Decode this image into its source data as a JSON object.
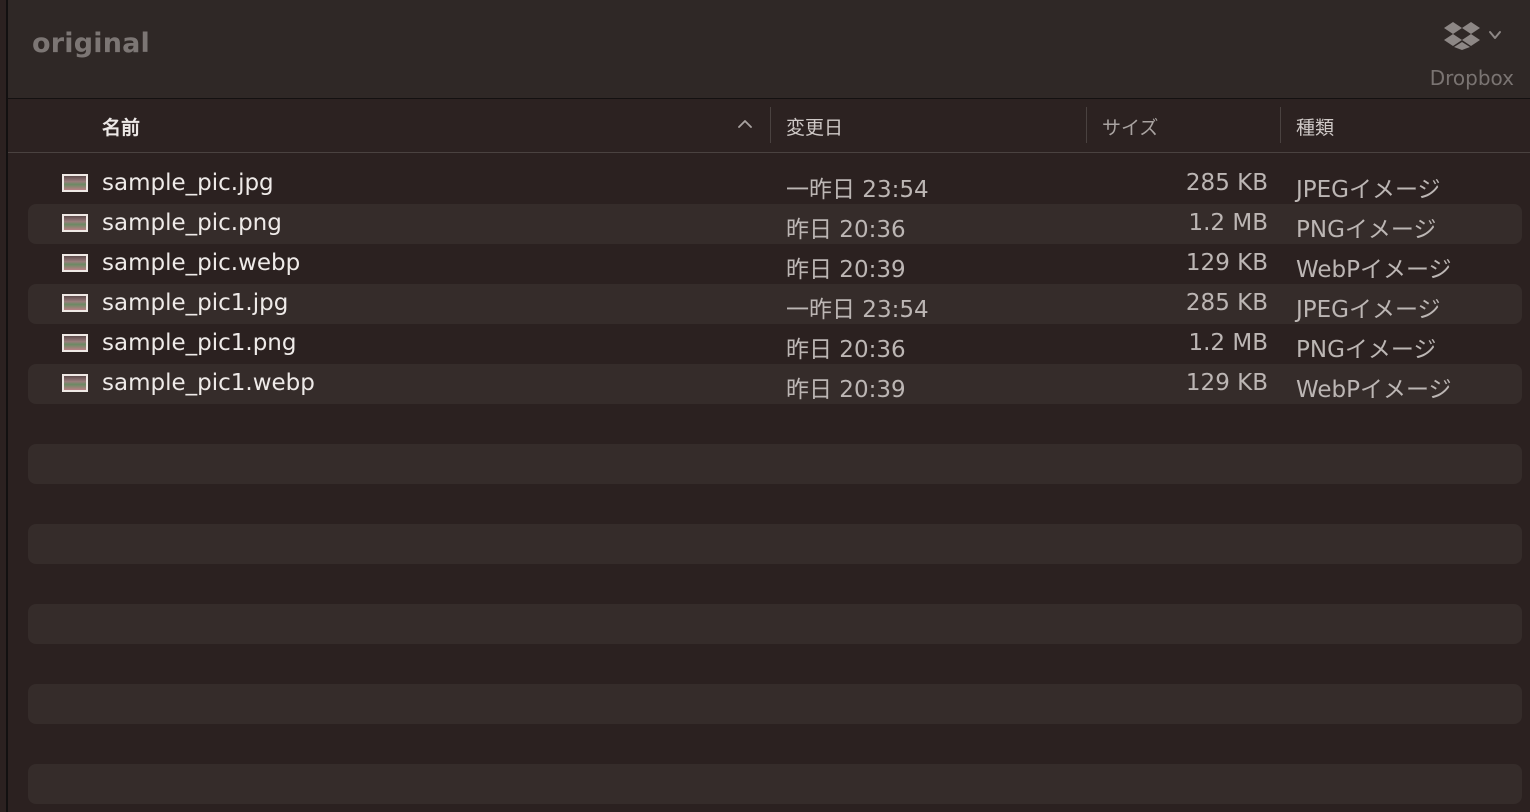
{
  "window": {
    "title": "original"
  },
  "toolbar": {
    "dropbox_label": "Dropbox",
    "dropbox_icon": "dropbox-icon",
    "dropbox_menu_icon": "chevron-down-icon"
  },
  "columns": {
    "name": "名前",
    "date": "変更日",
    "size": "サイズ",
    "kind": "種類",
    "sort_icon": "chevron-up-icon"
  },
  "files": [
    {
      "name": "sample_pic.jpg",
      "date": "一昨日 23:54",
      "size": "285 KB",
      "kind": "JPEGイメージ"
    },
    {
      "name": "sample_pic.png",
      "date": "昨日 20:36",
      "size": "1.2 MB",
      "kind": "PNGイメージ"
    },
    {
      "name": "sample_pic.webp",
      "date": "昨日 20:39",
      "size": "129 KB",
      "kind": "WebPイメージ"
    },
    {
      "name": "sample_pic1.jpg",
      "date": "一昨日 23:54",
      "size": "285 KB",
      "kind": "JPEGイメージ"
    },
    {
      "name": "sample_pic1.png",
      "date": "昨日 20:36",
      "size": "1.2 MB",
      "kind": "PNGイメージ"
    },
    {
      "name": "sample_pic1.webp",
      "date": "昨日 20:39",
      "size": "129 KB",
      "kind": "WebPイメージ"
    }
  ],
  "colors": {
    "background": "#2b2120",
    "stripe": "#352c2a",
    "text": "#eeeae8",
    "muted_text": "#bcb6b4"
  }
}
